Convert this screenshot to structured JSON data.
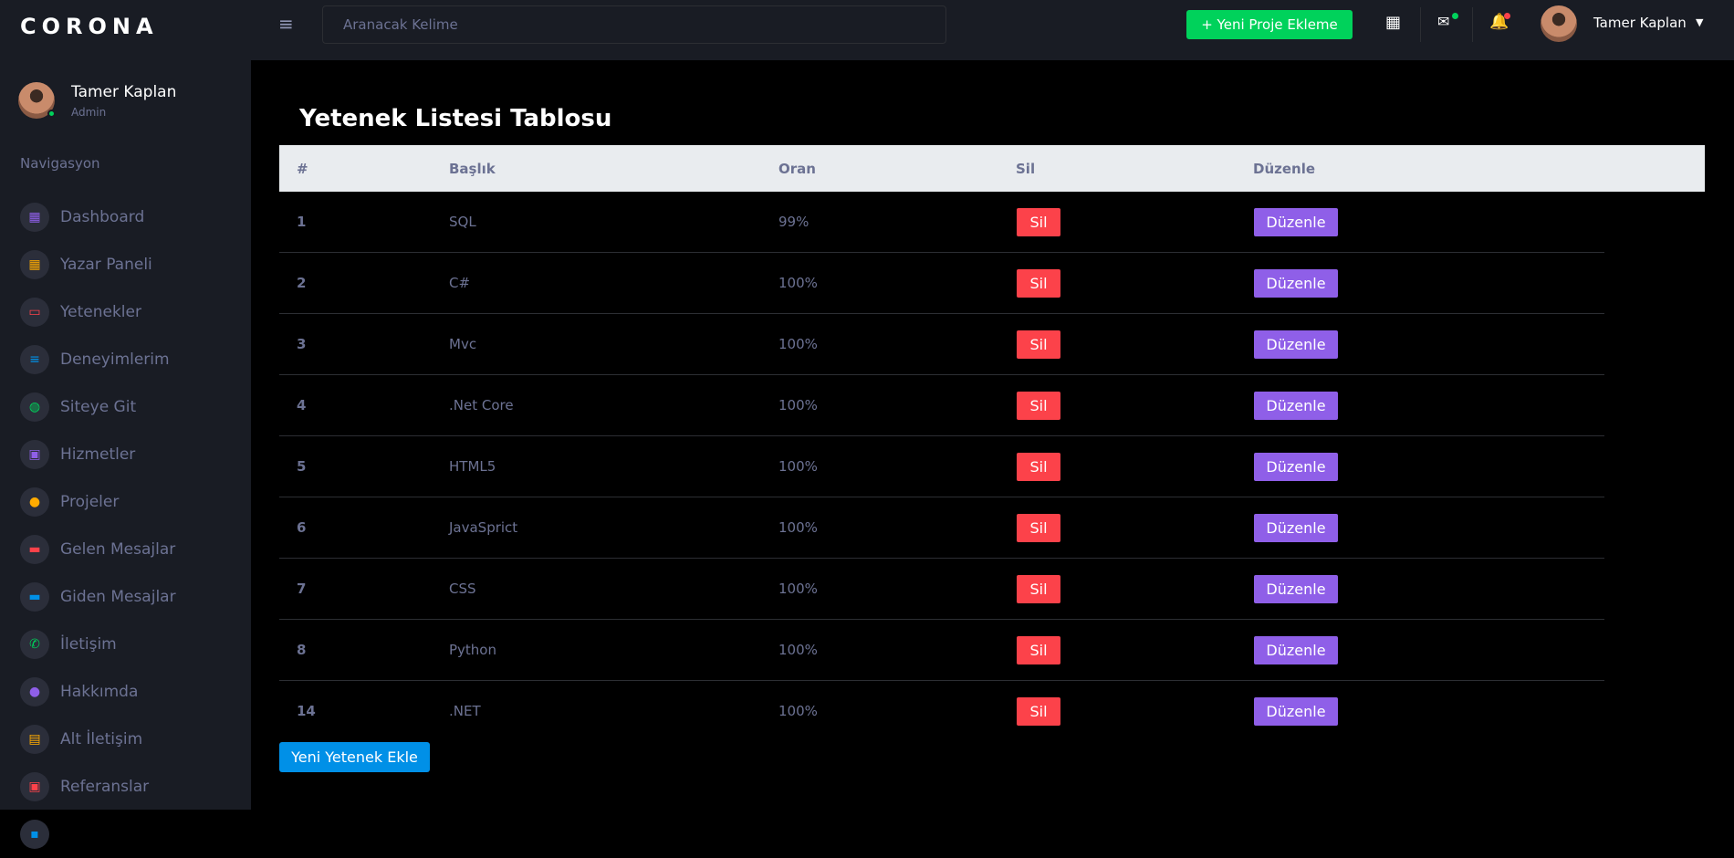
{
  "brand": "CORONA",
  "profile": {
    "name": "Tamer Kaplan",
    "role": "Admin"
  },
  "nav_category": "Navigasyon",
  "nav": [
    {
      "label": "Dashboard",
      "icon": "dashboard-icon",
      "glyph": "▦",
      "color": "#8f5fe8"
    },
    {
      "label": "Yazar Paneli",
      "icon": "panel-icon",
      "glyph": "▦",
      "color": "#ffab00"
    },
    {
      "label": "Yetenekler",
      "icon": "laptop-icon",
      "glyph": "▭",
      "color": "#fc424a"
    },
    {
      "label": "Deneyimlerim",
      "icon": "playlist-icon",
      "glyph": "≡",
      "color": "#0090e7"
    },
    {
      "label": "Siteye Git",
      "icon": "globe-icon",
      "glyph": "◍",
      "color": "#00d25b"
    },
    {
      "label": "Hizmetler",
      "icon": "contacts-icon",
      "glyph": "▣",
      "color": "#8f5fe8"
    },
    {
      "label": "Projeler",
      "icon": "github-icon",
      "glyph": "●",
      "color": "#ffab00"
    },
    {
      "label": "Gelen Mesajlar",
      "icon": "message-icon",
      "glyph": "▬",
      "color": "#fc424a"
    },
    {
      "label": "Giden Mesajlar",
      "icon": "chat-icon",
      "glyph": "▬",
      "color": "#0090e7"
    },
    {
      "label": "İletişim",
      "icon": "phone-icon",
      "glyph": "✆",
      "color": "#00d25b"
    },
    {
      "label": "Hakkımda",
      "icon": "person-icon",
      "glyph": "●",
      "color": "#8f5fe8"
    },
    {
      "label": "Alt İletişim",
      "icon": "calendar-icon",
      "glyph": "▤",
      "color": "#ffab00"
    },
    {
      "label": "Referanslar",
      "icon": "badge-icon",
      "glyph": "▣",
      "color": "#fc424a"
    },
    {
      "label": "",
      "icon": "partial-nav-icon",
      "glyph": "▪",
      "color": "#0090e7"
    }
  ],
  "topbar": {
    "search_placeholder": "Aranacak Kelime",
    "new_project_label": "+ Yeni Proje Ekleme",
    "user_name": "Tamer Kaplan"
  },
  "page_title": "Yetenek Listesi Tablosu",
  "table": {
    "headers": [
      "#",
      "Başlık",
      "Oran",
      "Sil",
      "Düzenle"
    ],
    "delete_label": "Sil",
    "edit_label": "Düzenle",
    "rows": [
      {
        "id": "1",
        "title": "SQL",
        "rate": "99%"
      },
      {
        "id": "2",
        "title": "C#",
        "rate": "100%"
      },
      {
        "id": "3",
        "title": "Mvc",
        "rate": "100%"
      },
      {
        "id": "4",
        "title": ".Net Core",
        "rate": "100%"
      },
      {
        "id": "5",
        "title": "HTML5",
        "rate": "100%"
      },
      {
        "id": "6",
        "title": "JavaSprict",
        "rate": "100%"
      },
      {
        "id": "7",
        "title": "CSS",
        "rate": "100%"
      },
      {
        "id": "8",
        "title": "Python",
        "rate": "100%"
      },
      {
        "id": "14",
        "title": ".NET",
        "rate": "100%"
      }
    ]
  },
  "add_skill_label": "Yeni Yetenek Ekle"
}
